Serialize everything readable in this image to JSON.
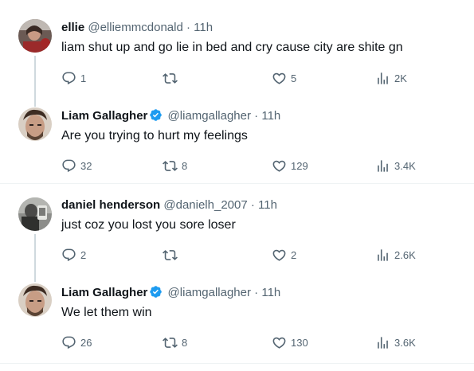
{
  "tweets": [
    {
      "name": "ellie",
      "handle": "@elliemmcdonald",
      "dot": "·",
      "time": "11h",
      "text": "liam shut up and go lie in bed and cry cause city are shite gn",
      "verified": false,
      "replies": "1",
      "retweets": "",
      "likes": "5",
      "views": "2K"
    },
    {
      "name": "Liam Gallagher",
      "handle": "@liamgallagher",
      "dot": "·",
      "time": "11h",
      "text": "Are you trying to hurt my feelings",
      "verified": true,
      "replies": "32",
      "retweets": "8",
      "likes": "129",
      "views": "3.4K"
    },
    {
      "name": "daniel henderson",
      "handle": "@danielh_2007",
      "dot": "·",
      "time": "11h",
      "text": "just coz you lost you sore loser",
      "verified": false,
      "replies": "2",
      "retweets": "",
      "likes": "2",
      "views": "2.6K"
    },
    {
      "name": "Liam Gallagher",
      "handle": "@liamgallagher",
      "dot": "·",
      "time": "11h",
      "text": "We let them win",
      "verified": true,
      "replies": "26",
      "retweets": "8",
      "likes": "130",
      "views": "3.6K"
    }
  ],
  "colors": {
    "text": "#0f1419",
    "secondary": "#536471",
    "verified": "#1d9bf0",
    "divider": "#eff3f4",
    "thread_line": "#cfd9de"
  }
}
